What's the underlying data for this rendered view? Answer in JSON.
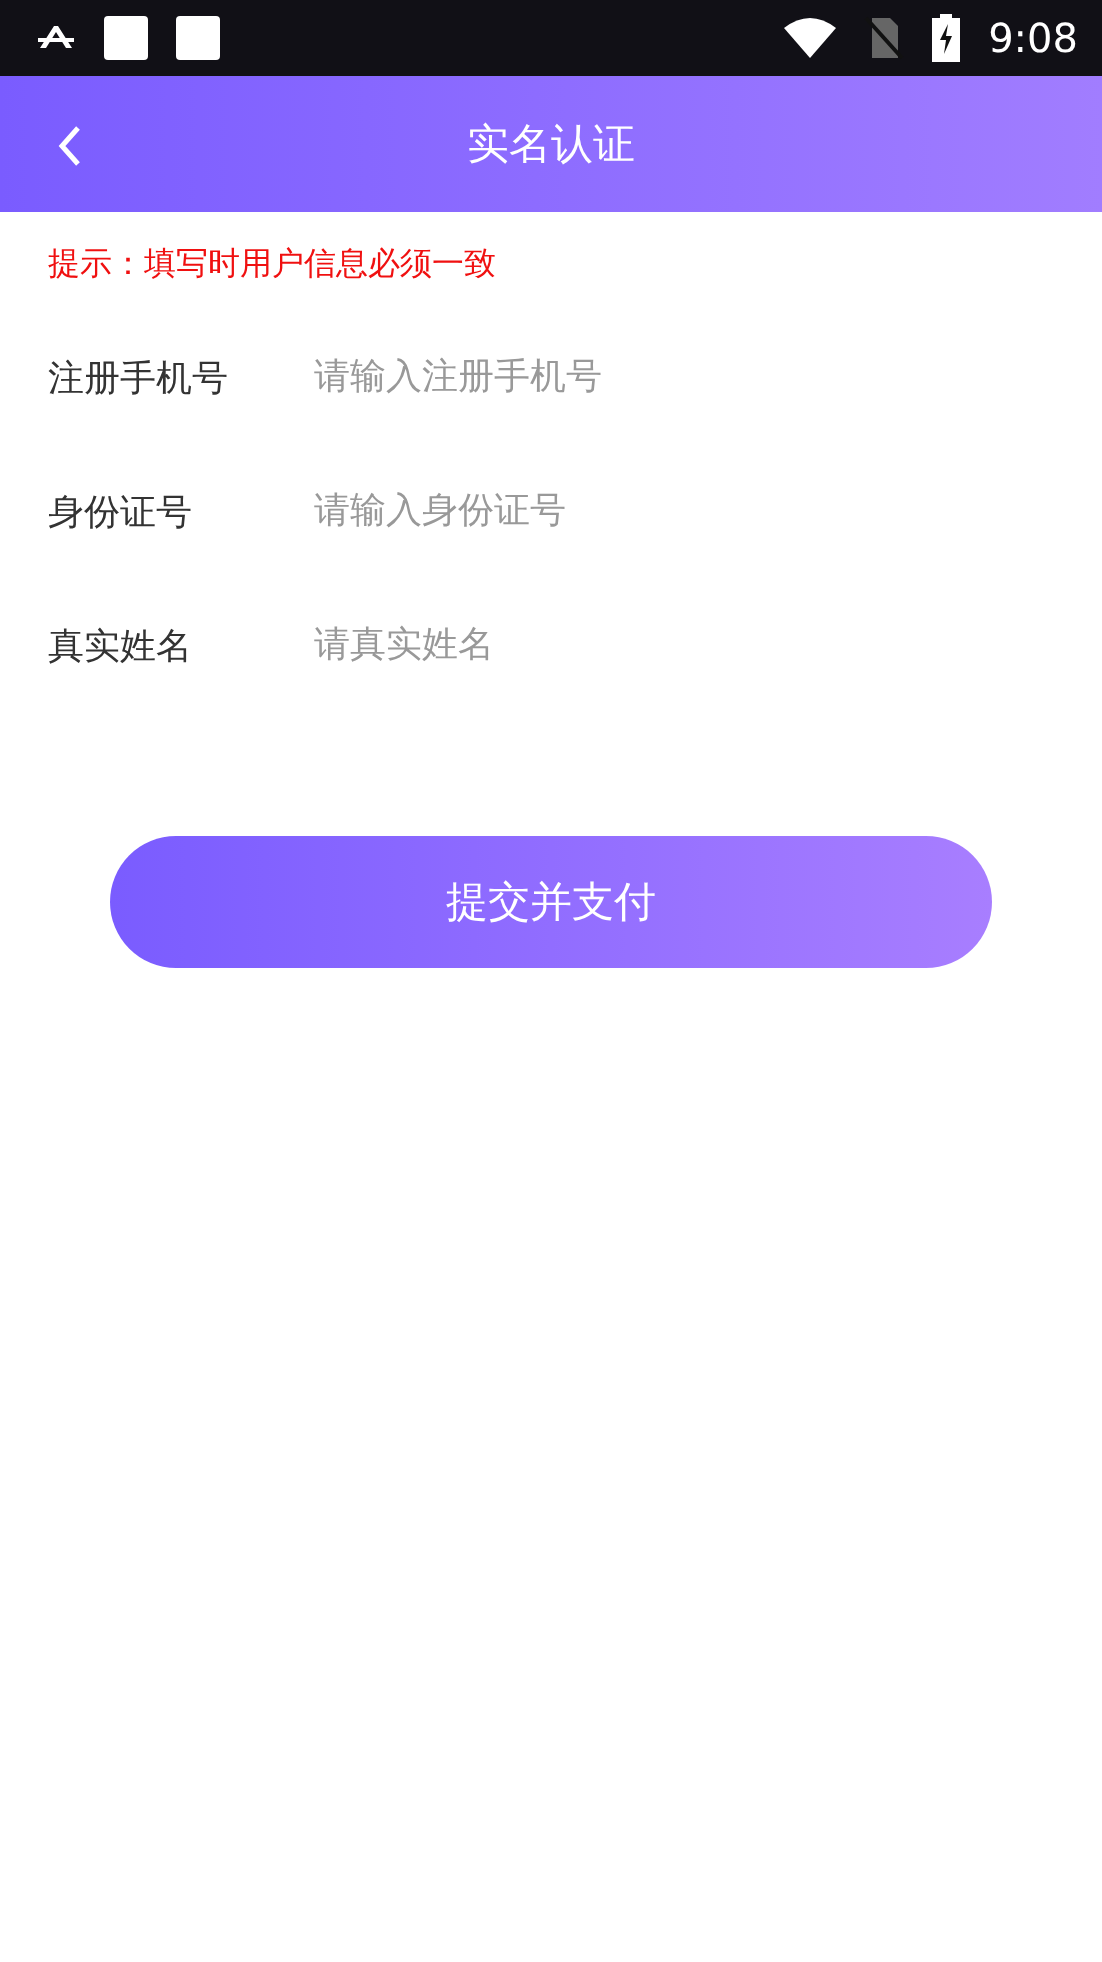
{
  "status_bar": {
    "time": "9:08"
  },
  "header": {
    "title": "实名认证"
  },
  "hint": "提示：填写时用户信息必须一致",
  "fields": [
    {
      "label": "注册手机号",
      "placeholder": "请输入注册手机号"
    },
    {
      "label": "身份证号",
      "placeholder": "请输入身份证号"
    },
    {
      "label": "真实姓名",
      "placeholder": "请真实姓名"
    }
  ],
  "submit": "提交并支付"
}
